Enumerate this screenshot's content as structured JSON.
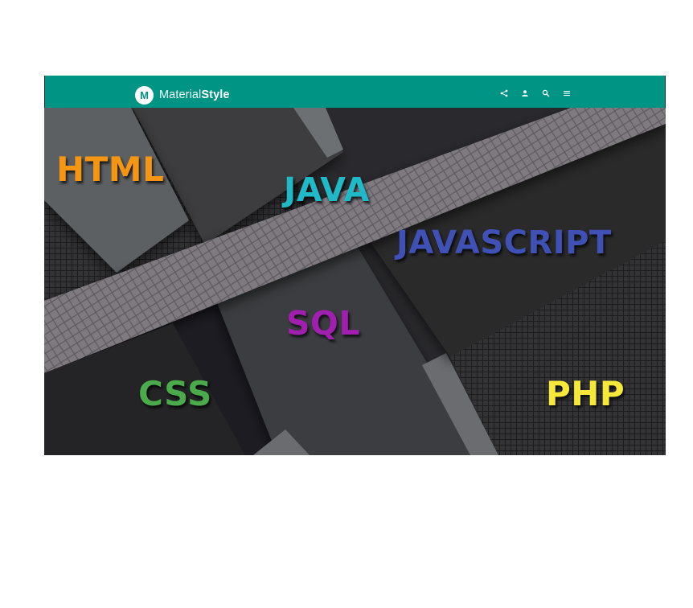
{
  "appbar": {
    "logo_letter": "M",
    "brand_thin": "Material",
    "brand_bold": "Style",
    "actions": [
      {
        "icon": "share-icon"
      },
      {
        "icon": "account-icon"
      },
      {
        "icon": "search-icon"
      },
      {
        "icon": "menu-icon"
      }
    ],
    "color": "#009485"
  },
  "hero": {
    "words": {
      "html": "HTML",
      "java": "JAVA",
      "javascript": "JAVASCRIPT",
      "sql": "SQL",
      "css": "CSS",
      "php": "PHP"
    },
    "colors": {
      "html": "#f59612",
      "java": "#1fb9c8",
      "javascript": "#3f51b5",
      "sql": "#a11fae",
      "css": "#4aaa4c",
      "php": "#f5e83a"
    }
  }
}
